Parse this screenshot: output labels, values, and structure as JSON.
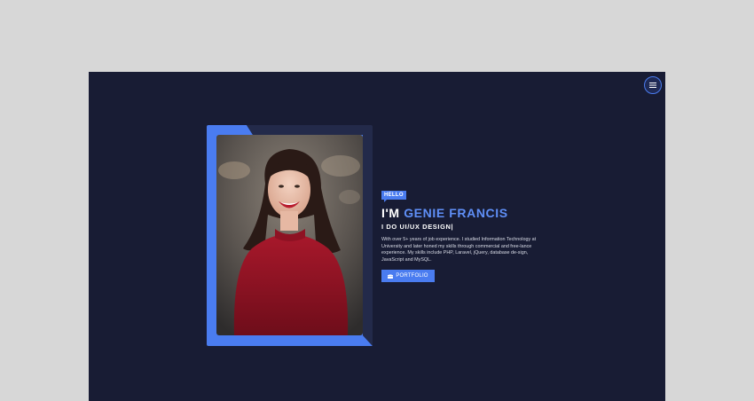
{
  "header": {
    "menu_icon": "hamburger-menu-icon"
  },
  "hero": {
    "badge": "HELLO",
    "greeting": "I'M",
    "name": "GENIE FRANCIS",
    "role": "I DO UI/UX DESIGN|",
    "bio": "With over 5+ years of job experience. I studied Information Technology at University and later honed my skills through commercial and free-lance experience. My skills include PHP, Laravel, jQuery, database de-sign, JavaScript and MySQL.",
    "cta_label": "PORTFOLIO",
    "cta_icon": "briefcase-icon"
  },
  "colors": {
    "page_bg": "#181c34",
    "accent": "#4a7cf0",
    "outer_bg": "#d7d7d7"
  }
}
